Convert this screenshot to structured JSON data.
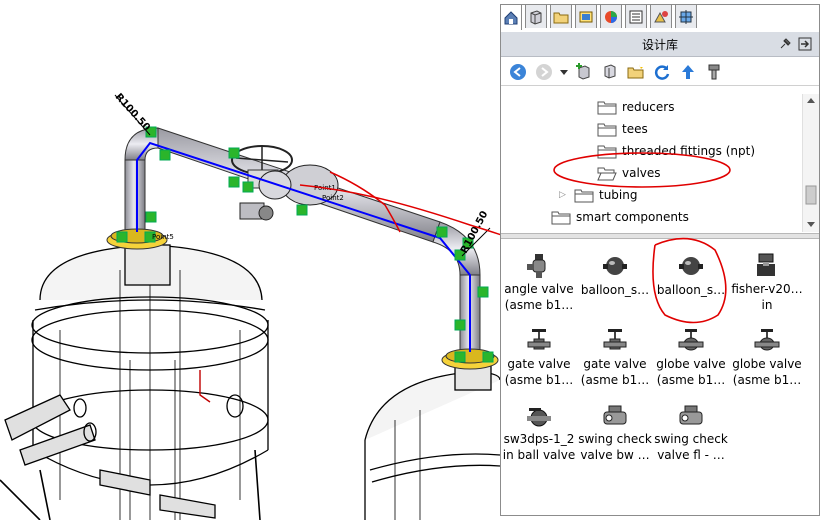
{
  "viewport": {
    "dimension_left": "R100.50",
    "dimension_right": "R100.50",
    "point_labels": [
      "Point2",
      "Point5",
      "Point1"
    ]
  },
  "panel": {
    "title": "设计库",
    "tabs": [
      "home-icon",
      "parts-icon",
      "design-library-icon",
      "file-explorer-icon",
      "appearances-icon",
      "custom-properties-icon",
      "view-palette-icon",
      "solidworks-forum-icon"
    ],
    "toolbar": [
      "back-icon",
      "forward-icon",
      "dropdown-icon",
      "add-to-library-icon",
      "add-location-icon",
      "create-folder-icon",
      "refresh-icon",
      "up-one-level-icon",
      "toolbox-icon"
    ]
  },
  "tree": {
    "items": [
      {
        "label": "reducers",
        "expander": ""
      },
      {
        "label": "tees",
        "expander": ""
      },
      {
        "label": "threaded fittings (npt)",
        "expander": ""
      },
      {
        "label": "valves",
        "expander": ""
      },
      {
        "label": "tubing",
        "expander": "▷"
      },
      {
        "label": "smart components",
        "expander": ""
      }
    ]
  },
  "components": [
    {
      "line1": "angle valve",
      "line2": "(asme b1…",
      "icon": "angle-valve-icon"
    },
    {
      "line1": "balloon_s…",
      "line2": "",
      "icon": "balloon-valve-icon"
    },
    {
      "line1": "balloon_s…",
      "line2": "",
      "icon": "balloon-valve-icon"
    },
    {
      "line1": "fisher-v20…",
      "line2": "in",
      "icon": "fisher-valve-icon"
    },
    {
      "line1": "gate valve",
      "line2": "(asme b1…",
      "icon": "gate-valve-icon"
    },
    {
      "line1": "gate valve",
      "line2": "(asme b1…",
      "icon": "gate-valve-icon"
    },
    {
      "line1": "globe valve",
      "line2": "(asme b1…",
      "icon": "globe-valve-icon"
    },
    {
      "line1": "globe valve",
      "line2": "(asme b1…",
      "icon": "globe-valve-icon"
    },
    {
      "line1": "sw3dps-1_2",
      "line2": "in ball valve",
      "icon": "ball-valve-icon"
    },
    {
      "line1": "swing check",
      "line2": "valve   bw …",
      "icon": "swing-check-valve-icon"
    },
    {
      "line1": "swing check",
      "line2": "valve  fl - …",
      "icon": "swing-check-valve-icon"
    }
  ],
  "colors": {
    "route_line": "#0000ff",
    "annotation": "#e00000",
    "panel_title_bg": "#d9dde4",
    "connection_marker": "#2bb52b"
  }
}
